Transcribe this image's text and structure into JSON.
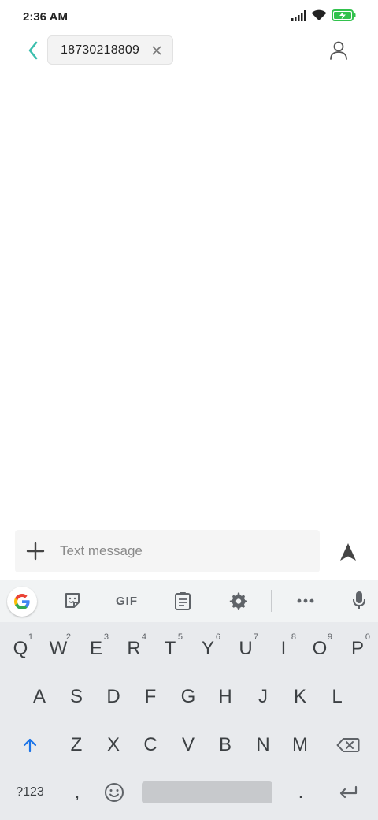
{
  "status_bar": {
    "time": "2:36 AM",
    "icons": [
      "signal-icon",
      "wifi-icon",
      "battery-charging-icon"
    ]
  },
  "header": {
    "recipient_number": "18730218809"
  },
  "compose": {
    "placeholder": "Text message",
    "value": ""
  },
  "keyboard": {
    "toolbar": {
      "gif_label": "GIF"
    },
    "row1": [
      {
        "label": "Q",
        "hint": "1"
      },
      {
        "label": "W",
        "hint": "2"
      },
      {
        "label": "E",
        "hint": "3"
      },
      {
        "label": "R",
        "hint": "4"
      },
      {
        "label": "T",
        "hint": "5"
      },
      {
        "label": "Y",
        "hint": "6"
      },
      {
        "label": "U",
        "hint": "7"
      },
      {
        "label": "I",
        "hint": "8"
      },
      {
        "label": "O",
        "hint": "9"
      },
      {
        "label": "P",
        "hint": "0"
      }
    ],
    "row2": [
      "A",
      "S",
      "D",
      "F",
      "G",
      "H",
      "J",
      "K",
      "L"
    ],
    "row3": [
      "Z",
      "X",
      "C",
      "V",
      "B",
      "N",
      "M"
    ],
    "row4": {
      "symbols_label": "?123",
      "comma_label": ",",
      "period_label": "."
    }
  },
  "colors": {
    "accent_teal": "#3cbfae",
    "keyboard_bg": "#e8eaed",
    "shift_blue": "#1a73e8"
  }
}
